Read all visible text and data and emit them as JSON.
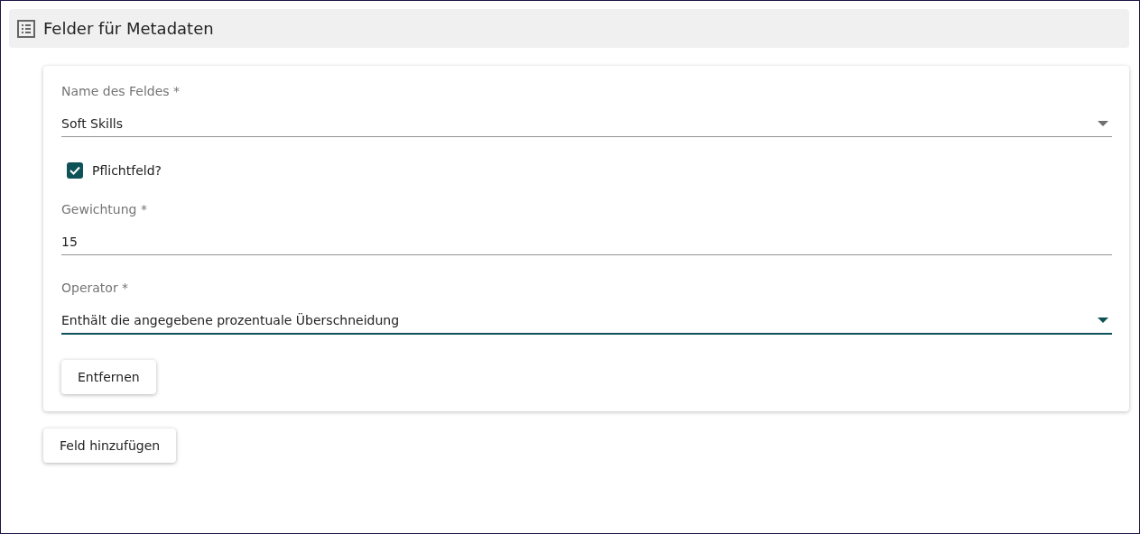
{
  "header": {
    "title": "Felder für Metadaten"
  },
  "fields": [
    {
      "kind": "select",
      "label": "Name des Feldes *",
      "value": "Soft Skills",
      "focused": false
    },
    {
      "kind": "checkbox",
      "label": "Pflichtfeld?",
      "checked": true
    },
    {
      "kind": "text",
      "label": "Gewichtung *",
      "value": "15",
      "focused": false
    },
    {
      "kind": "select",
      "label": "Operator *",
      "value": "Enthält die angegebene prozentuale Überschneidung",
      "focused": true
    }
  ],
  "remove_button": "Entfernen",
  "add_button": "Feld hinzufügen"
}
